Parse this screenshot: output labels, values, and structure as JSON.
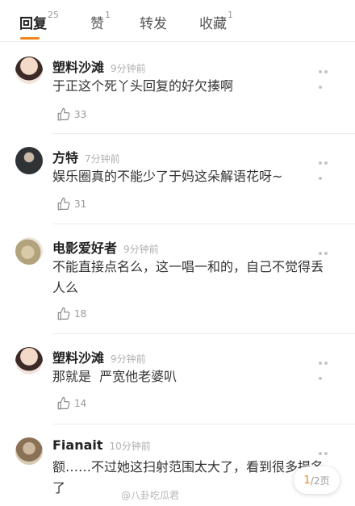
{
  "tabs": [
    {
      "label": "回复",
      "count": "25",
      "active": true
    },
    {
      "label": "赞",
      "count": "1",
      "active": false
    },
    {
      "label": "转发",
      "count": "",
      "active": false
    },
    {
      "label": "收藏",
      "count": "1",
      "active": false
    }
  ],
  "comments": [
    {
      "user": "塑料沙滩",
      "time": "9分钟前",
      "text": "于正这个死丫头回复的好欠揍啊",
      "likes": "33"
    },
    {
      "user": "方特",
      "time": "7分钟前",
      "text": "娱乐圈真的不能少了于妈这朵解语花呀~",
      "likes": "31"
    },
    {
      "user": "电影爱好者",
      "time": "9分钟前",
      "text": "不能直接点名么，这一唱一和的，自己不觉得丢人么",
      "likes": "18"
    },
    {
      "user": "塑料沙滩",
      "time": "9分钟前",
      "text": "那就是  严宽他老婆叭",
      "likes": "14"
    },
    {
      "user": "Fianait",
      "time": "10分钟前",
      "text": "额……不过她这扫射范围太大了，看到很多提名了",
      "likes": ""
    }
  ],
  "pagination": {
    "current": "1",
    "total": "/2页"
  },
  "watermark": "@八卦吃瓜君",
  "colors": {
    "accent": "#f0861e",
    "text": "#333333",
    "muted": "#b0b0b0"
  }
}
